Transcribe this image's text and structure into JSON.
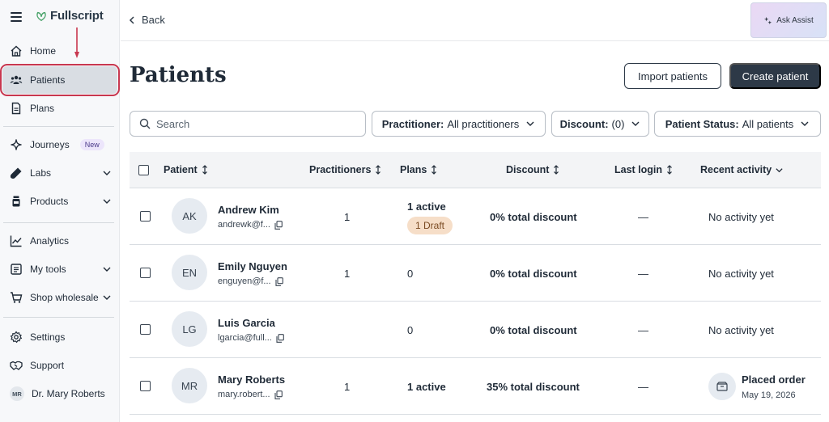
{
  "brand": {
    "name": "Fullscript"
  },
  "sidebar": {
    "items": [
      {
        "label": "Home",
        "icon": "home-icon"
      },
      {
        "label": "Patients",
        "icon": "users-icon",
        "active": true
      },
      {
        "label": "Plans",
        "icon": "document-icon"
      },
      {
        "label": "Journeys",
        "icon": "sparkle-icon",
        "badge": "New"
      },
      {
        "label": "Labs",
        "icon": "test-tube-icon",
        "expandable": true
      },
      {
        "label": "Products",
        "icon": "bottle-icon",
        "expandable": true
      },
      {
        "label": "Analytics",
        "icon": "chart-line-icon"
      },
      {
        "label": "My tools",
        "icon": "toolbox-icon",
        "expandable": true
      },
      {
        "label": "Shop wholesale",
        "icon": "cart-icon",
        "expandable": true
      },
      {
        "label": "Settings",
        "icon": "gear-icon"
      },
      {
        "label": "Support",
        "icon": "handshake-icon"
      }
    ],
    "user": {
      "initials": "MR",
      "name": "Dr. Mary Roberts"
    }
  },
  "topbar": {
    "back_label": "Back",
    "assist_label": "Ask Assist"
  },
  "page": {
    "title": "Patients",
    "import_label": "Import patients",
    "create_label": "Create patient"
  },
  "search": {
    "placeholder": "Search"
  },
  "filters": {
    "practitioner": {
      "key": "Practitioner:",
      "value": "All practitioners"
    },
    "discount": {
      "key": "Discount:",
      "value": "(0)"
    },
    "status": {
      "key": "Patient Status:",
      "value": "All patients"
    }
  },
  "table": {
    "headers": {
      "patient": "Patient",
      "practitioners": "Practitioners",
      "plans": "Plans",
      "discount": "Discount",
      "last_login": "Last login",
      "recent_activity": "Recent activity"
    },
    "rows": [
      {
        "initials": "AK",
        "name": "Andrew Kim",
        "email": "andrewk@f...",
        "practitioners": "1",
        "plans": "1 active",
        "plans_bold": true,
        "draft": "1 Draft",
        "discount": "0% total discount",
        "last_login": "—",
        "activity": "No activity yet"
      },
      {
        "initials": "EN",
        "name": "Emily Nguyen",
        "email": "enguyen@f...",
        "practitioners": "1",
        "plans": "0",
        "discount": "0% total discount",
        "last_login": "—",
        "activity": "No activity yet"
      },
      {
        "initials": "LG",
        "name": "Luis Garcia",
        "email": "lgarcia@full...",
        "practitioners": "",
        "plans": "0",
        "discount": "0% total discount",
        "last_login": "—",
        "activity": "No activity yet"
      },
      {
        "initials": "MR",
        "name": "Mary Roberts",
        "email": "mary.robert...",
        "practitioners": "1",
        "plans": "1 active",
        "plans_bold": true,
        "discount": "35% total discount",
        "last_login": "—",
        "activity_title": "Placed order",
        "activity_date": "May 19, 2026"
      }
    ]
  }
}
